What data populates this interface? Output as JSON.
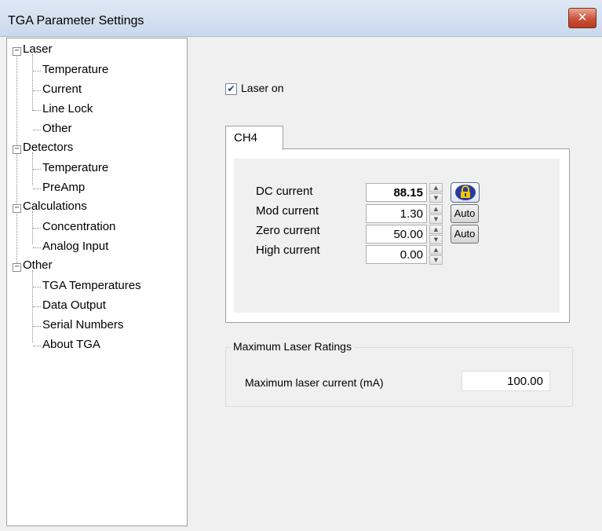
{
  "window": {
    "title": "TGA Parameter Settings",
    "close_glyph": "✕"
  },
  "tree": {
    "expander_glyph": "−",
    "groups": [
      {
        "label": "Laser",
        "children": [
          "Temperature",
          "Current",
          "Line Lock",
          "Other"
        ]
      },
      {
        "label": "Detectors",
        "children": [
          "Temperature",
          "PreAmp"
        ]
      },
      {
        "label": "Calculations",
        "children": [
          "Concentration",
          "Analog Input"
        ]
      },
      {
        "label": "Other",
        "children": [
          "TGA Temperatures",
          "Data Output",
          "Serial Numbers",
          "About TGA"
        ]
      }
    ]
  },
  "laser_on": {
    "label": "Laser on",
    "checked": true,
    "check_glyph": "✔"
  },
  "tabs": [
    {
      "label": "CH4",
      "selected": true
    }
  ],
  "currents": {
    "dc": {
      "label": "DC current",
      "value": "88.15",
      "bold": true,
      "lock_icon": "lock-icon"
    },
    "mod": {
      "label": "Mod current",
      "value": "1.30",
      "button": "Auto"
    },
    "zero": {
      "label": "Zero current",
      "value": "50.00",
      "button": "Auto"
    },
    "high": {
      "label": "High current",
      "value": "0.00"
    }
  },
  "spin_glyphs": {
    "up": "▲",
    "down": "▼"
  },
  "max_ratings": {
    "title": "Maximum Laser Ratings",
    "label": "Maximum laser current (mA)",
    "value": "100.00"
  },
  "colors": {
    "titlebar": "#c9d9ec",
    "close_button": "#c9533a",
    "lock_blue": "#2a3a9c",
    "lock_yellow": "#f3c400"
  }
}
